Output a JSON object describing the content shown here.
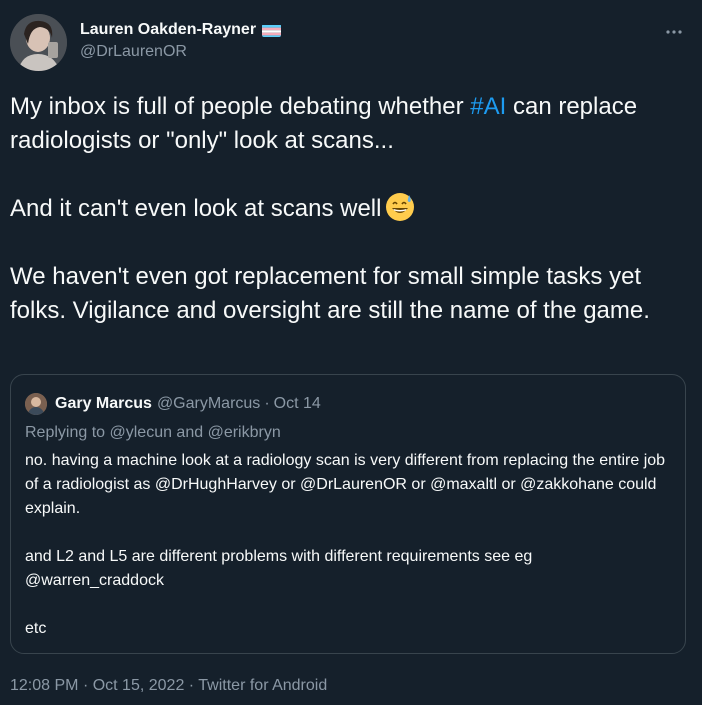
{
  "author": {
    "display_name": "Lauren Oakden-Rayner",
    "handle": "@DrLaurenOR",
    "flag_icon": "transgender-flag-icon"
  },
  "tweet": {
    "para1_a": "My inbox is full of people debating whether ",
    "hashtag": "#AI",
    "para1_b": " can replace radiologists or \"only\" look at scans...",
    "para2": "And it can't even look at scans well",
    "emoji_icon": "grinning-sweat-emoji",
    "para3": "We haven't even got replacement for small simple tasks yet folks. Vigilance and oversight are still the name of the game."
  },
  "quoted": {
    "name": "Gary Marcus",
    "handle": "@GaryMarcus",
    "dot": "·",
    "date": "Oct 14",
    "replying": "Replying to @ylecun and @erikbryn",
    "para1": "no. having a machine look at a radiology scan is very different from replacing the entire job of a radiologist as  @DrHughHarvey or @DrLaurenOR or @maxaltl or @zakkohane could explain.",
    "para2": "and L2 and L5 are different problems with different requirements see eg @warren_craddock",
    "para3": "etc"
  },
  "footer": {
    "time": "12:08 PM",
    "dot1": "·",
    "date": "Oct 15, 2022",
    "dot2": "·",
    "source": "Twitter for Android"
  },
  "colors": {
    "background": "#15202b",
    "text": "#f7f9f9",
    "secondary": "#8b98a5",
    "accent": "#1d9bf0",
    "border": "#38444d"
  }
}
